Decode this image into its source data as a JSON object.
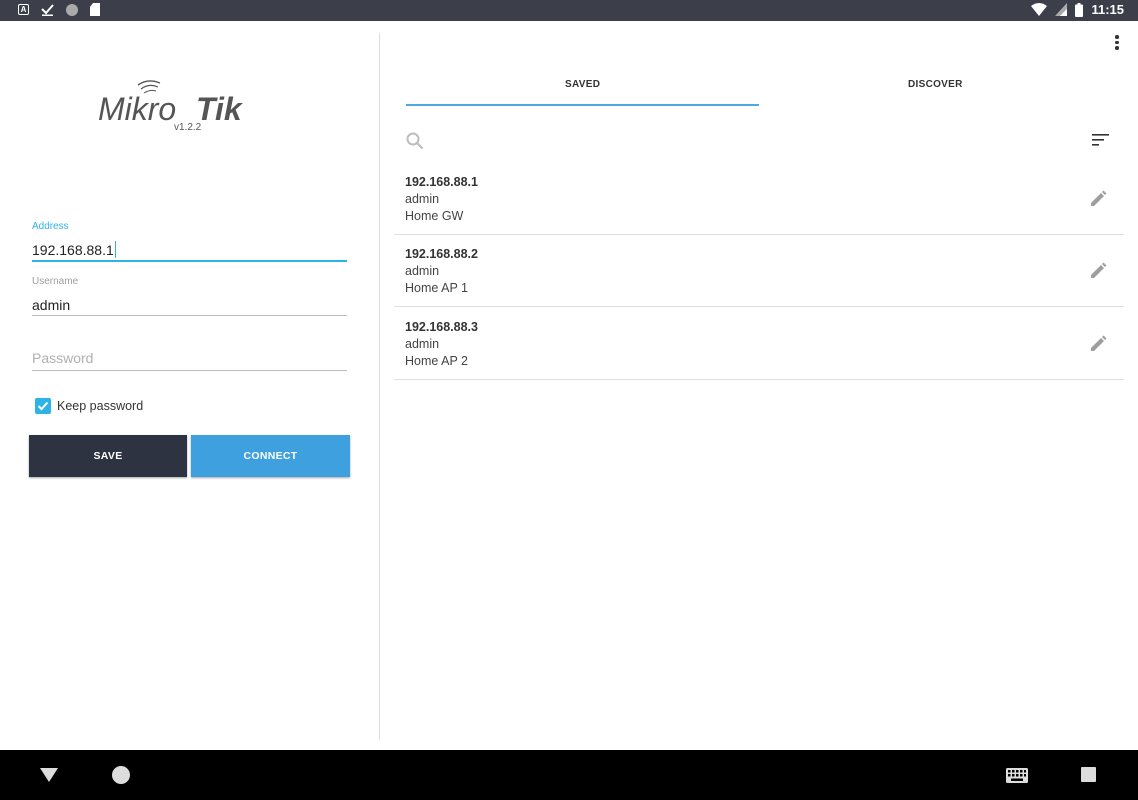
{
  "status_bar": {
    "time": "11:15",
    "left_icons": [
      "app-a-icon",
      "check-icon",
      "circle-icon",
      "sd-card-icon"
    ],
    "right_icons": [
      "wifi-icon",
      "signal-icon",
      "battery-icon"
    ]
  },
  "login": {
    "logo_text": "MikroTik",
    "version": "v1.2.2",
    "address": {
      "label": "Address",
      "value": "192.168.88.1"
    },
    "username": {
      "label": "Username",
      "value": "admin"
    },
    "password": {
      "placeholder": "Password",
      "value": ""
    },
    "keep_password": {
      "label": "Keep password",
      "checked": true
    },
    "save_label": "SAVE",
    "connect_label": "CONNECT"
  },
  "tabs": [
    {
      "label": "SAVED",
      "active": true
    },
    {
      "label": "DISCOVER",
      "active": false
    }
  ],
  "saved_list": [
    {
      "address": "192.168.88.1",
      "user": "admin",
      "name": "Home GW"
    },
    {
      "address": "192.168.88.2",
      "user": "admin",
      "name": "Home AP 1"
    },
    {
      "address": "192.168.88.3",
      "user": "admin",
      "name": "Home AP 2"
    }
  ],
  "colors": {
    "accent": "#2db3e6",
    "save_button": "#2d3340",
    "connect_button": "#3fa0df",
    "status_bar": "#3c3f4a"
  },
  "nav_bar_icons": [
    "back-icon",
    "home-icon",
    "keyboard-icon",
    "recents-icon"
  ]
}
